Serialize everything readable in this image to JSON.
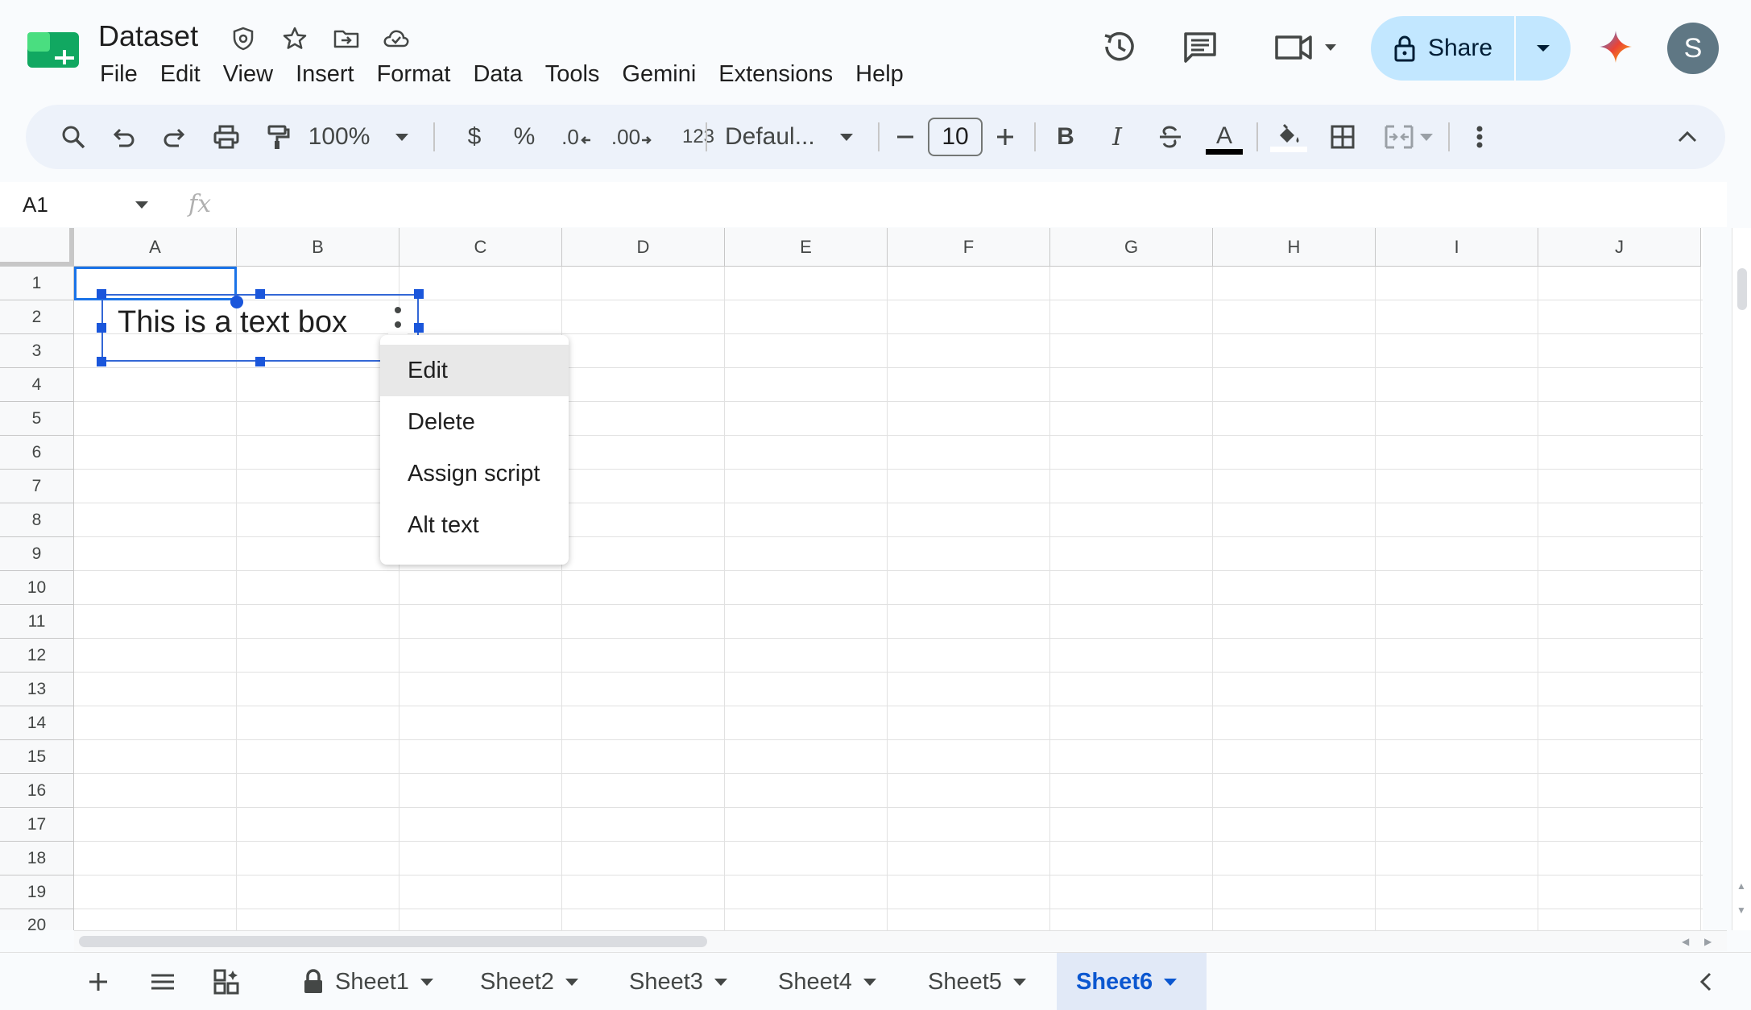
{
  "header": {
    "title": "Dataset",
    "title_icons": [
      "shield-icon",
      "star-icon",
      "move-to-folder-icon",
      "cloud-saved-icon"
    ],
    "menu": [
      "File",
      "Edit",
      "View",
      "Insert",
      "Format",
      "Data",
      "Tools",
      "Gemini",
      "Extensions",
      "Help"
    ],
    "share_label": "Share",
    "avatar_letter": "S",
    "accent": "#c2e7ff"
  },
  "toolbar": {
    "zoom": "100%",
    "currency": "$",
    "percent": "%",
    "decrease_decimal": ".0",
    "increase_decimal": ".00",
    "number_format": "123",
    "font": "Defaul...",
    "font_size": "10",
    "bold": "B",
    "italic": "I",
    "text_color_letter": "A"
  },
  "formula_bar": {
    "name_box": "A1",
    "fx": "fx"
  },
  "grid": {
    "columns": [
      "A",
      "B",
      "C",
      "D",
      "E",
      "F",
      "G",
      "H",
      "I",
      "J"
    ],
    "rows": [
      "1",
      "2",
      "3",
      "4",
      "5",
      "6",
      "7",
      "8",
      "9",
      "10",
      "11",
      "12",
      "13",
      "14",
      "15",
      "16",
      "17",
      "18",
      "19",
      "20"
    ],
    "selected_cell": "A1"
  },
  "text_box": {
    "content": "This is a text box"
  },
  "context_menu": {
    "items": [
      "Edit",
      "Delete",
      "Assign script",
      "Alt text"
    ],
    "highlighted": "Edit"
  },
  "sheets": {
    "tabs": [
      "Sheet1",
      "Sheet2",
      "Sheet3",
      "Sheet4",
      "Sheet5",
      "Sheet6"
    ],
    "active": "Sheet6",
    "locked": "Sheet1",
    "active_color": "#0b57d0"
  }
}
